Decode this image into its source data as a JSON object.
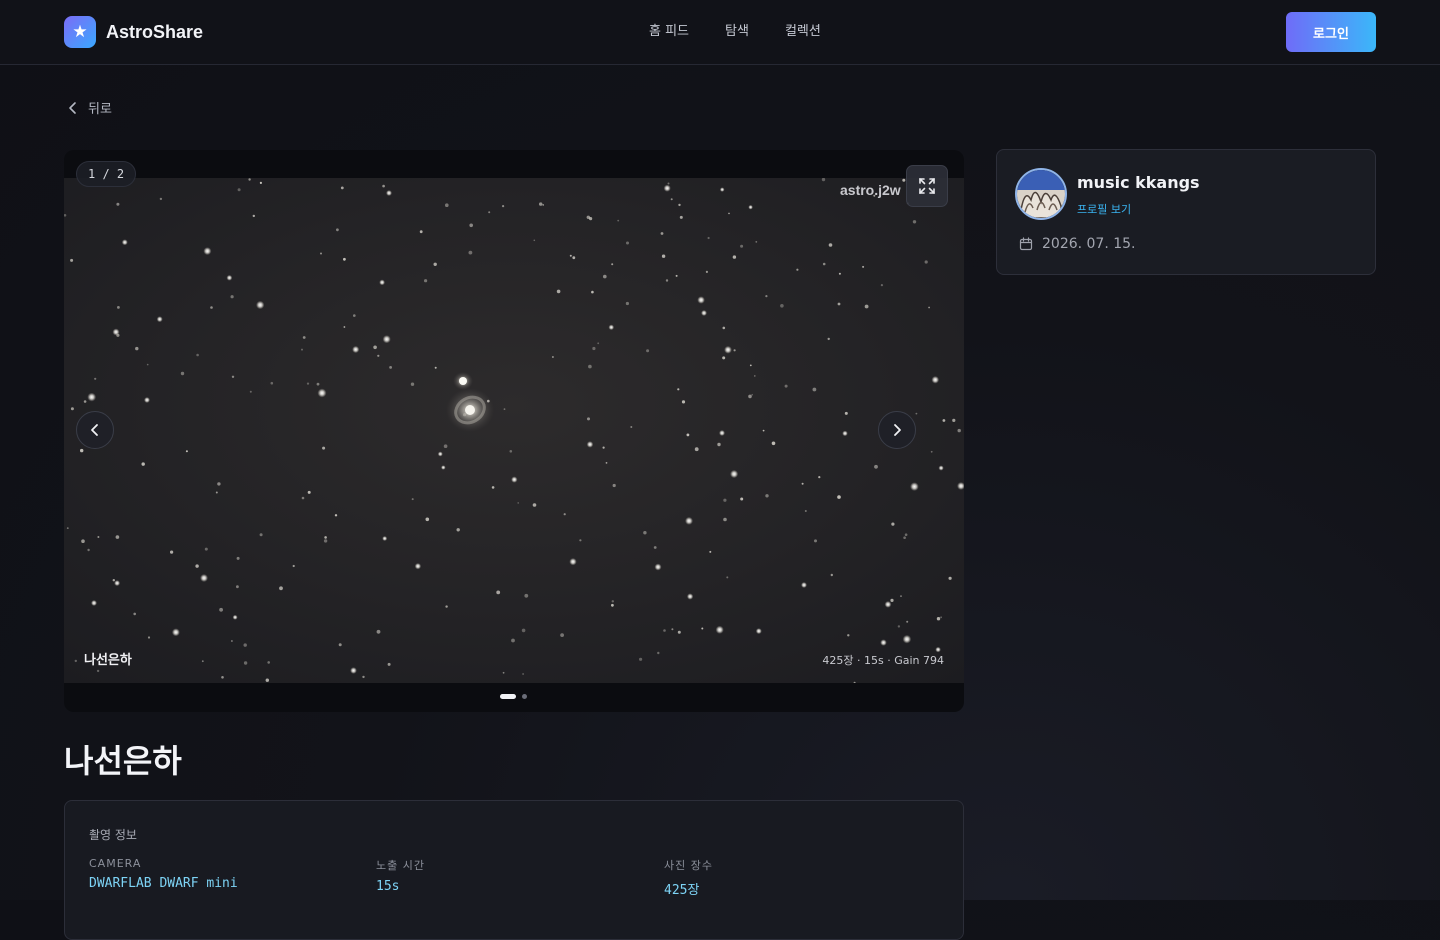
{
  "header": {
    "brand": "AstroShare",
    "logo_icon": "star-icon",
    "nav": [
      "홈 피드",
      "탐색",
      "컬렉션"
    ],
    "login_label": "로그인",
    "colors": {
      "accent_start": "#6f6cf8",
      "accent_end": "#3bb7f9"
    }
  },
  "back": {
    "label": "뒤로",
    "icon": "chevron-left-icon"
  },
  "viewer": {
    "counter": "1 / 2",
    "watermark": "astro.j2w",
    "caption_title": "나선은하",
    "caption_stats": "425장 · 15s · Gain 794",
    "slide_count": 2,
    "active_slide": 1,
    "icons": {
      "expand": "expand-icon",
      "prev": "chevron-left-icon",
      "next": "chevron-right-icon"
    }
  },
  "post": {
    "title": "나선은하"
  },
  "info": {
    "heading": "촬영 정보",
    "fields": [
      {
        "label": "CAMERA",
        "value": "DWARFLAB DWARF mini"
      },
      {
        "label": "노출 시간",
        "value": "15s"
      },
      {
        "label": "사진 장수",
        "value": "425장"
      }
    ]
  },
  "author": {
    "name": "music kkangs",
    "profile_link": "프로필 보기",
    "date": "2026. 07. 15.",
    "date_icon": "calendar-icon"
  }
}
